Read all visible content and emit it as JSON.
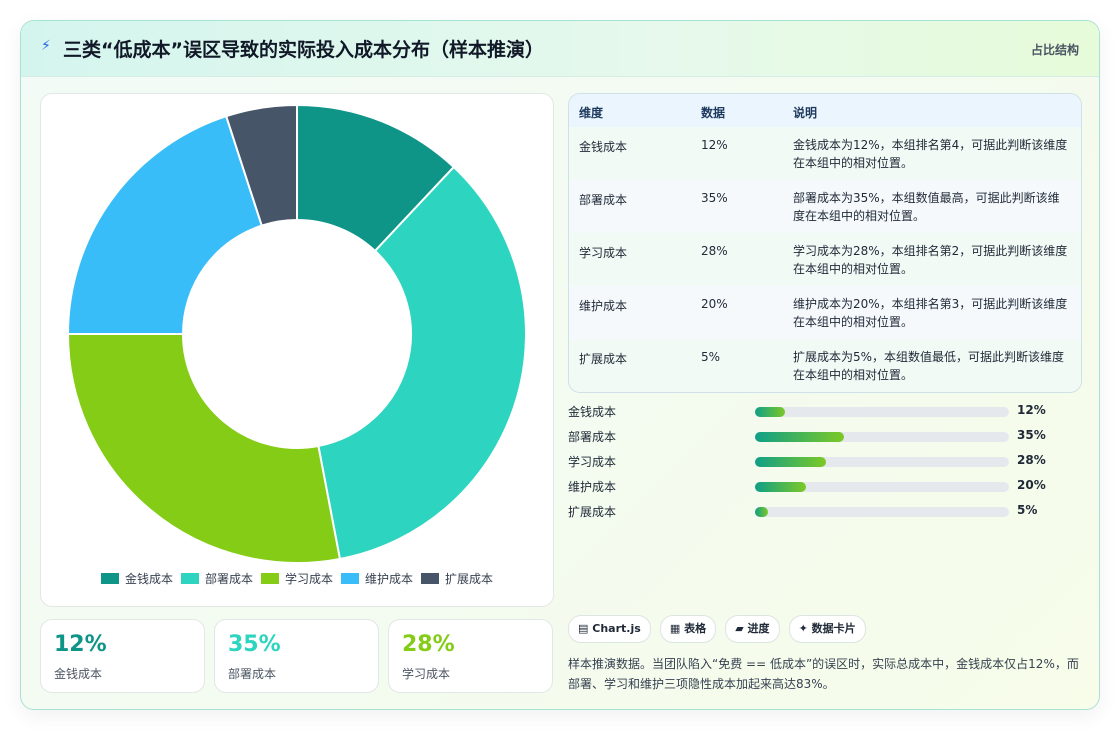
{
  "header": {
    "icon": "lightning-icon",
    "title": "三类“低成本”误区导致的实际投入成本分布（样本推演）",
    "tag": "占比结构"
  },
  "colors": {
    "money": "#0f9488",
    "deploy": "#2dd4bf",
    "learn": "#84cc16",
    "maintain": "#38bdf8",
    "extend": "#475569"
  },
  "chart_data": {
    "type": "pie",
    "style": "donut",
    "categories": [
      "金钱成本",
      "部署成本",
      "学习成本",
      "维护成本",
      "扩展成本"
    ],
    "values": [
      12,
      35,
      28,
      20,
      5
    ],
    "unit": "%",
    "colors": [
      "#0f9488",
      "#2dd4bf",
      "#84cc16",
      "#38bdf8",
      "#475569"
    ],
    "legend_position": "bottom"
  },
  "stat_cards": [
    {
      "value": "12%",
      "label": "金钱成本",
      "color": "#0f9488"
    },
    {
      "value": "35%",
      "label": "部署成本",
      "color": "#2dd4bf"
    },
    {
      "value": "28%",
      "label": "学习成本",
      "color": "#84cc16"
    }
  ],
  "table": {
    "headers": [
      "维度",
      "数据",
      "说明"
    ],
    "rows": [
      {
        "dim": "金钱成本",
        "val": "12%",
        "desc": "金钱成本为12%，本组排名第4，可据此判断该维度在本组中的相对位置。"
      },
      {
        "dim": "部署成本",
        "val": "35%",
        "desc": "部署成本为35%，本组数值最高，可据此判断该维度在本组中的相对位置。"
      },
      {
        "dim": "学习成本",
        "val": "28%",
        "desc": "学习成本为28%，本组排名第2，可据此判断该维度在本组中的相对位置。"
      },
      {
        "dim": "维护成本",
        "val": "20%",
        "desc": "维护成本为20%，本组排名第3，可据此判断该维度在本组中的相对位置。"
      },
      {
        "dim": "扩展成本",
        "val": "5%",
        "desc": "扩展成本为5%，本组数值最低，可据此判断该维度在本组中的相对位置。"
      }
    ]
  },
  "progress": [
    {
      "label": "金钱成本",
      "pct_text": "12%",
      "value": 12
    },
    {
      "label": "部署成本",
      "pct_text": "35%",
      "value": 35
    },
    {
      "label": "学习成本",
      "pct_text": "28%",
      "value": 28
    },
    {
      "label": "维护成本",
      "pct_text": "20%",
      "value": 20
    },
    {
      "label": "扩展成本",
      "pct_text": "5%",
      "value": 5
    }
  ],
  "tags": [
    {
      "icon": "chart-icon",
      "glyph": "▤",
      "label": "Chart.js"
    },
    {
      "icon": "table-icon",
      "glyph": "▦",
      "label": "表格"
    },
    {
      "icon": "progress-icon",
      "glyph": "▰",
      "label": "进度"
    },
    {
      "icon": "card-icon",
      "glyph": "✦",
      "label": "数据卡片"
    }
  ],
  "note": "样本推演数据。当团队陷入“免费 == 低成本”的误区时，实际总成本中，金钱成本仅占12%，而部署、学习和维护三项隐性成本加起来高达83%。"
}
